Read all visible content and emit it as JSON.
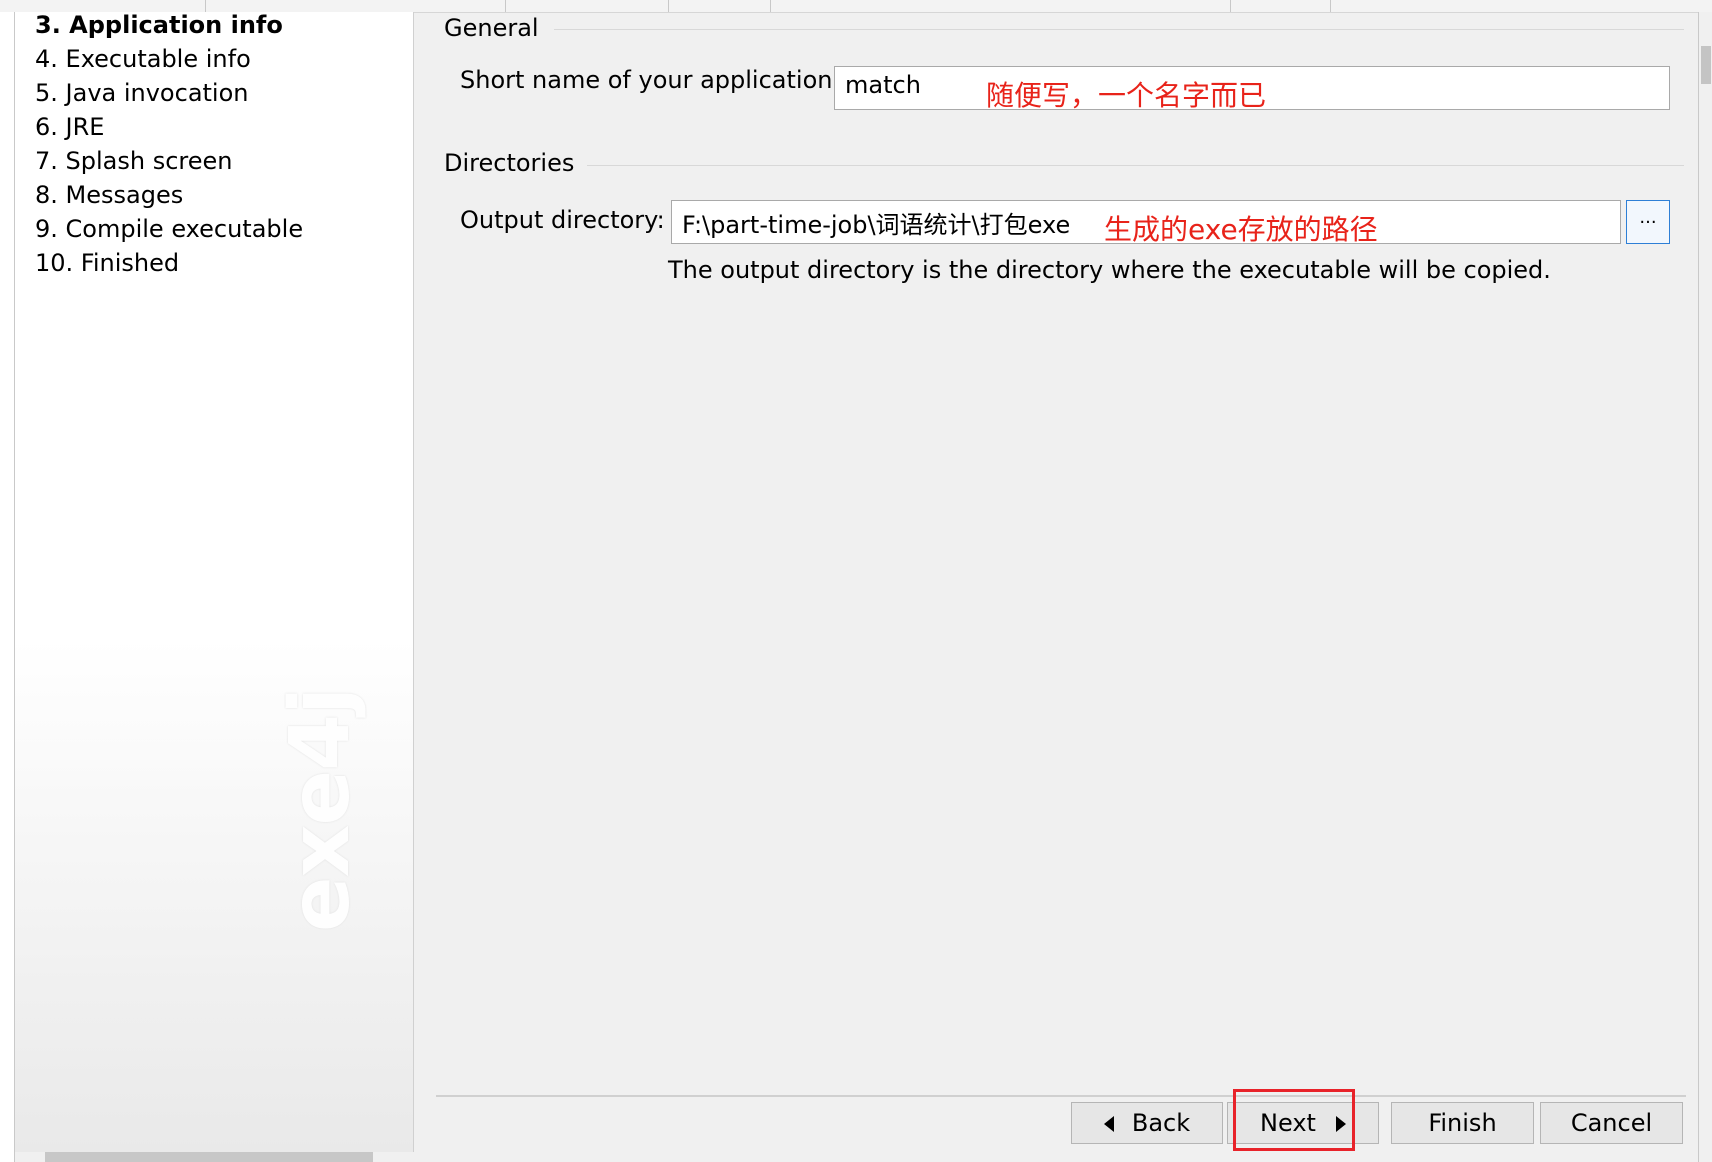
{
  "sidebar": {
    "steps": [
      {
        "label": "3. Application info",
        "active": true
      },
      {
        "label": "4. Executable info",
        "active": false
      },
      {
        "label": "5. Java invocation",
        "active": false
      },
      {
        "label": "6. JRE",
        "active": false
      },
      {
        "label": "7. Splash screen",
        "active": false
      },
      {
        "label": "8. Messages",
        "active": false
      },
      {
        "label": "9. Compile executable",
        "active": false
      },
      {
        "label": "10. Finished",
        "active": false
      }
    ],
    "watermark": "exe4j"
  },
  "general": {
    "title": "General",
    "short_name_label": "Short name of your application:",
    "short_name_value": "match",
    "short_name_annotation": "随便写，一个名字而已"
  },
  "directories": {
    "title": "Directories",
    "output_label": "Output directory:",
    "output_value": "F:\\part-time-job\\词语统计\\打包exe",
    "output_annotation": "生成的exe存放的路径",
    "browse_label": "...",
    "help_text": "The output directory is the directory where the executable will be copied."
  },
  "buttons": {
    "back": "Back",
    "next": "Next",
    "finish": "Finish",
    "cancel": "Cancel"
  },
  "colors": {
    "annotation": "#e8231a",
    "highlight_box": "#e8232a",
    "browse_border": "#2e7fd6"
  }
}
